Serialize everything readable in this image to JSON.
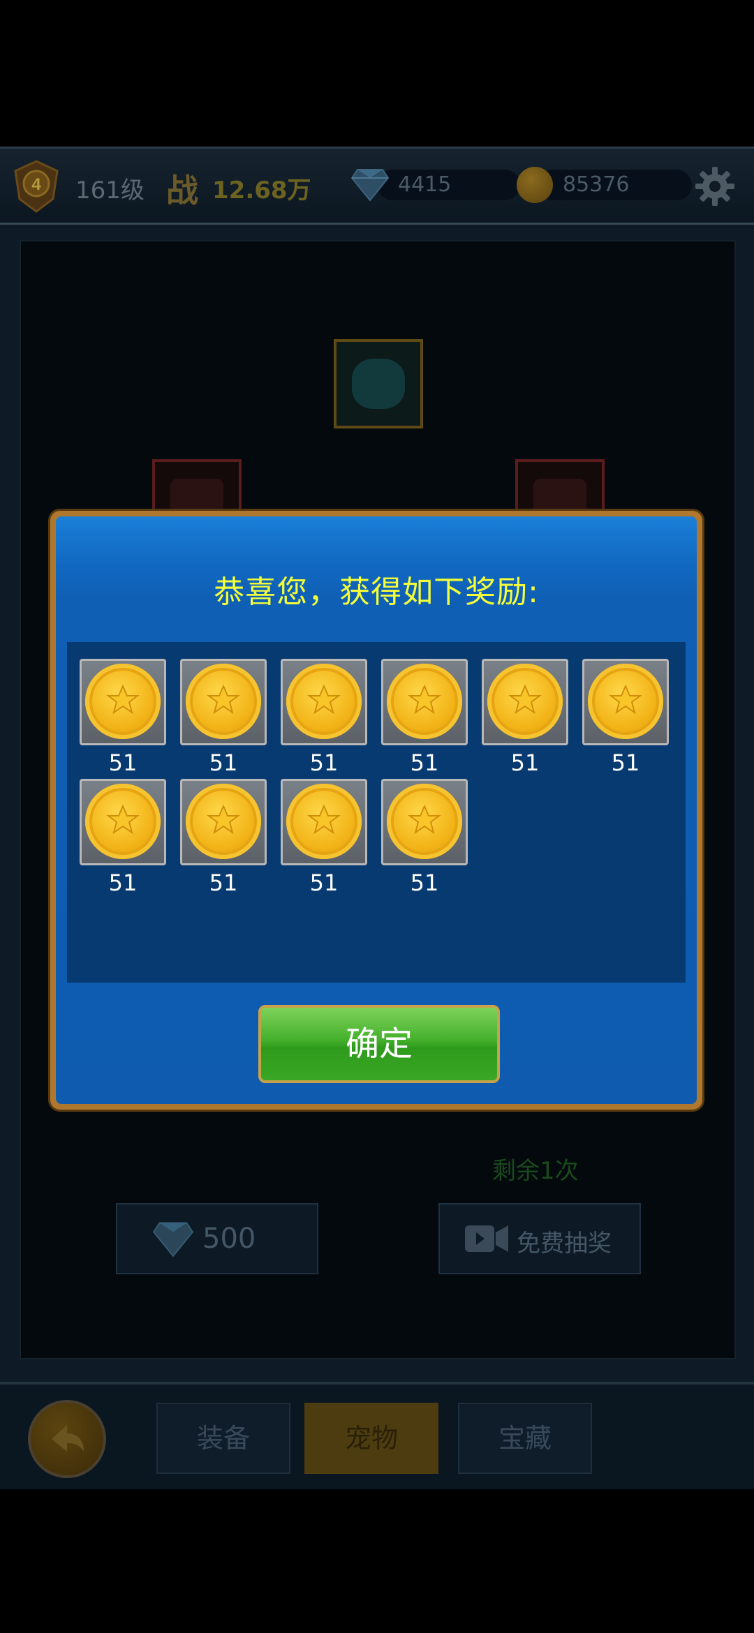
{
  "topbar": {
    "level_badge": "4",
    "level_text": "161级",
    "power_label": "战",
    "power_value": "12.68万",
    "gems": "4415",
    "coins": "85376"
  },
  "game": {
    "remaining_text": "剩余1次",
    "gem_cost": "500",
    "free_draw_label": "免费抽奖"
  },
  "nav": {
    "tabs": [
      {
        "label": "装备"
      },
      {
        "label": "宠物"
      },
      {
        "label": "宝藏"
      }
    ],
    "active_tab": "宠物"
  },
  "modal": {
    "title": "恭喜您，获得如下奖励:",
    "rewards": [
      {
        "icon": "gold-coin-icon",
        "count": "51"
      },
      {
        "icon": "gold-coin-icon",
        "count": "51"
      },
      {
        "icon": "gold-coin-icon",
        "count": "51"
      },
      {
        "icon": "gold-coin-icon",
        "count": "51"
      },
      {
        "icon": "gold-coin-icon",
        "count": "51"
      },
      {
        "icon": "gold-coin-icon",
        "count": "51"
      },
      {
        "icon": "gold-coin-icon",
        "count": "51"
      },
      {
        "icon": "gold-coin-icon",
        "count": "51"
      },
      {
        "icon": "gold-coin-icon",
        "count": "51"
      },
      {
        "icon": "gold-coin-icon",
        "count": "51"
      }
    ],
    "confirm_label": "确定"
  },
  "colors": {
    "modal_blue": "#0e5bb0",
    "title_yellow": "#f4ff3a",
    "confirm_green": "#44b02c",
    "coin_gold": "#f2b418"
  }
}
